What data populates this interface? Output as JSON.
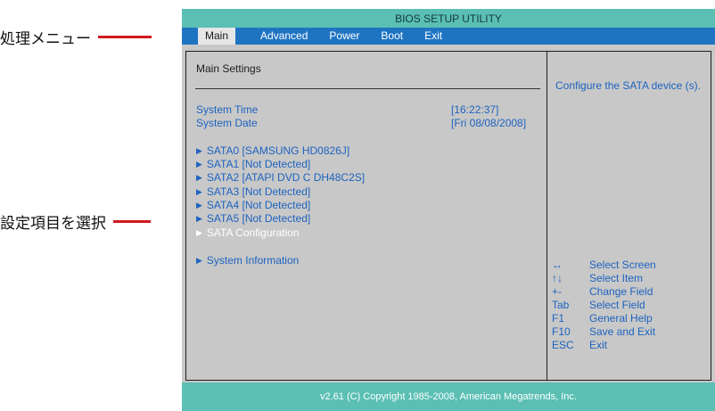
{
  "callouts": {
    "menu": "処理メニュー",
    "select": "設定項目を選択"
  },
  "title": "BIOS SETUP UTILITY",
  "menu": [
    "Main",
    "Advanced",
    "Power",
    "Boot",
    "Exit"
  ],
  "main": {
    "section_title": "Main  Settings",
    "system_time_label": "System  Time",
    "system_time_value": "[16:22:37]",
    "system_date_label": "System  Date",
    "system_date_value": "[Fri  08/08/2008]",
    "items": [
      "SATA0  [SAMSUNG  HD0826J]",
      "SATA1  [Not  Detected]",
      "SATA2  [ATAPI     DVD  C    DH48C2S]",
      "SATA3  [Not  Detected]",
      "SATA4  [Not  Detected]",
      "SATA5  [Not  Detected]",
      "SATA  Configuration",
      "System  Information"
    ]
  },
  "help": {
    "description": "Configure  the  SATA device (s).",
    "keys": [
      {
        "key": "↔",
        "desc": "Select Screen"
      },
      {
        "key": "↑↓",
        "desc": "Select Item"
      },
      {
        "key": "+-",
        "desc": "Change Field"
      },
      {
        "key": "Tab",
        "desc": "Select Field"
      },
      {
        "key": "F1",
        "desc": "General Help"
      },
      {
        "key": "F10",
        "desc": "Save and Exit"
      },
      {
        "key": "ESC",
        "desc": "Exit"
      }
    ]
  },
  "footer": "v2.61 (C) Copyright  1985-2008, American Megatrends, Inc.",
  "colors": {
    "title_bar": "#5bbfb4",
    "menu_bar": "#1f74c2",
    "panel_bg": "#c8c8c8",
    "item_text": "#1d63c0",
    "callout_line": "#d0191e"
  }
}
